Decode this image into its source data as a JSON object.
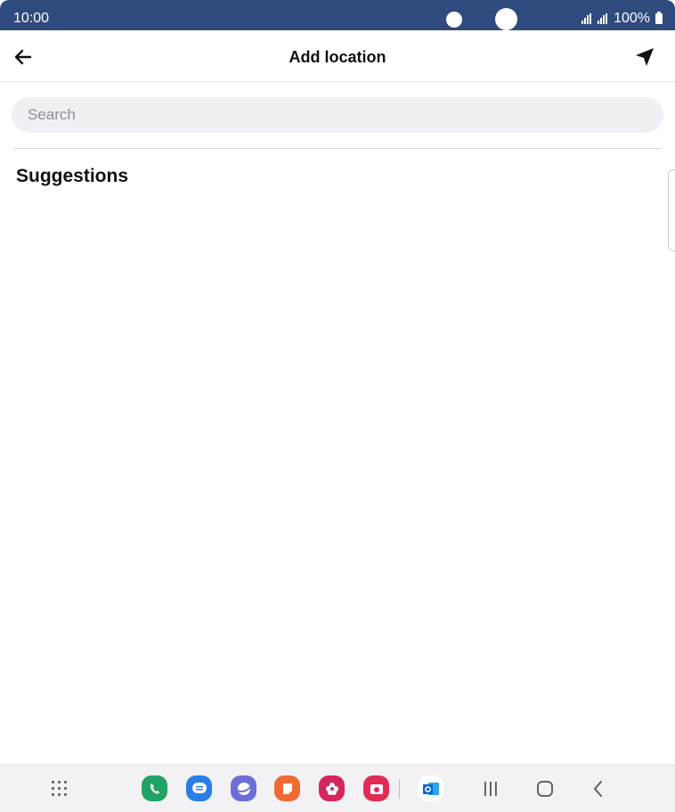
{
  "status_bar": {
    "time": "10:00",
    "battery": "100%",
    "background_color": "#2f4a7d"
  },
  "header": {
    "title": "Add location",
    "back_icon": "arrow-left-icon",
    "location_icon": "navigation-arrow-icon"
  },
  "search": {
    "placeholder": "Search",
    "value": ""
  },
  "suggestions": {
    "heading": "Suggestions",
    "items": []
  },
  "dock": {
    "apps": [
      {
        "name": "phone-app-icon",
        "color": "#1fa463"
      },
      {
        "name": "messages-app-icon",
        "color": "#2b7de9"
      },
      {
        "name": "internet-app-icon",
        "color": "#6c6fd8"
      },
      {
        "name": "notes-app-icon",
        "color": "#f06a35"
      },
      {
        "name": "gallery-app-icon",
        "color": "#d6245e"
      },
      {
        "name": "camera-app-icon",
        "color": "#e02c55"
      },
      {
        "name": "outlook-app-icon",
        "color": "#0a64c8"
      }
    ]
  },
  "navigation": {
    "keys": [
      "recents-icon",
      "home-icon",
      "back-nav-icon"
    ]
  }
}
